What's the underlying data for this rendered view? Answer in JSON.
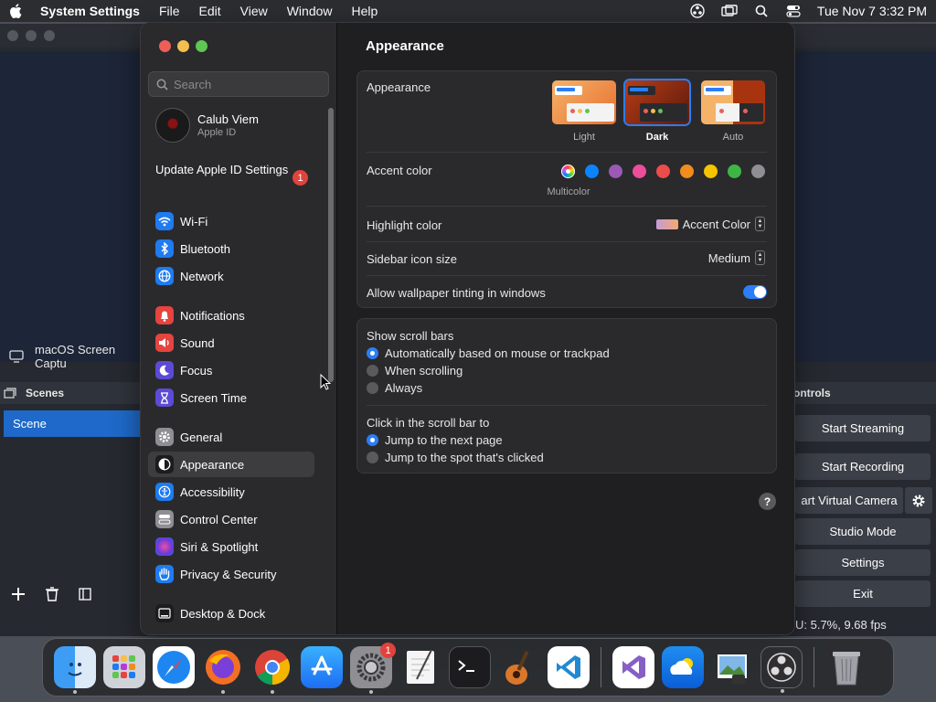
{
  "menubar": {
    "app_name": "System Settings",
    "menus": [
      "File",
      "Edit",
      "View",
      "Window",
      "Help"
    ],
    "clock": "Tue Nov 7  3:32 PM"
  },
  "obs": {
    "source_label": "macOS Screen Captu",
    "scenes_header": "Scenes",
    "scene_item": "Scene",
    "controls_header": "ontrols",
    "buttons": {
      "start_streaming": "Start Streaming",
      "start_recording": "Start Recording",
      "virtual_camera": "art Virtual Camera",
      "studio_mode": "Studio Mode",
      "settings": "Settings",
      "exit": "Exit"
    },
    "status": "U: 5.7%, 9.68 fps"
  },
  "sidebar": {
    "search_placeholder": "Search",
    "profile": {
      "name": "Calub Viem",
      "subtitle": "Apple ID"
    },
    "update": {
      "label": "Update Apple ID Settings",
      "badge": "1"
    },
    "items": [
      {
        "label": "Wi-Fi",
        "icon": "wifi-icon",
        "color": "#1e7bf0"
      },
      {
        "label": "Bluetooth",
        "icon": "bluetooth-icon",
        "color": "#1e7bf0"
      },
      {
        "label": "Network",
        "icon": "globe-icon",
        "color": "#1e7bf0"
      },
      {
        "label": "Notifications",
        "icon": "bell-icon",
        "color": "#e5443f"
      },
      {
        "label": "Sound",
        "icon": "speaker-icon",
        "color": "#e5443f"
      },
      {
        "label": "Focus",
        "icon": "moon-icon",
        "color": "#5b4bd6"
      },
      {
        "label": "Screen Time",
        "icon": "hourglass-icon",
        "color": "#5b4bd6"
      },
      {
        "label": "General",
        "icon": "gear-icon",
        "color": "#8e8e93"
      },
      {
        "label": "Appearance",
        "icon": "appearance-icon",
        "color": "#1c1c1e"
      },
      {
        "label": "Accessibility",
        "icon": "accessibility-icon",
        "color": "#1e7bf0"
      },
      {
        "label": "Control Center",
        "icon": "control-center-icon",
        "color": "#8e8e93"
      },
      {
        "label": "Siri & Spotlight",
        "icon": "siri-icon",
        "color": "#b83ad8"
      },
      {
        "label": "Privacy & Security",
        "icon": "hand-icon",
        "color": "#1e7bf0"
      },
      {
        "label": "Desktop & Dock",
        "icon": "dock-icon",
        "color": "#1c1c1e"
      }
    ]
  },
  "content": {
    "title": "Appearance",
    "appearance": {
      "label": "Appearance",
      "options": [
        "Light",
        "Dark",
        "Auto"
      ],
      "selected": "Dark"
    },
    "accent": {
      "label": "Accent color",
      "caption": "Multicolor",
      "colors": [
        "#0a84ff",
        "#9b59b6",
        "#ec4e9a",
        "#ed4c4c",
        "#f28c1c",
        "#f5c400",
        "#3fb544",
        "#8e8e93"
      ]
    },
    "highlight": {
      "label": "Highlight color",
      "value": "Accent Color"
    },
    "sidebar_icon_size": {
      "label": "Sidebar icon size",
      "value": "Medium"
    },
    "wallpaper_tinting": {
      "label": "Allow wallpaper tinting in windows",
      "enabled": true
    },
    "scroll_bars": {
      "label": "Show scroll bars",
      "options": [
        "Automatically based on mouse or trackpad",
        "When scrolling",
        "Always"
      ],
      "selected": "Automatically based on mouse or trackpad"
    },
    "click_scroll": {
      "label": "Click in the scroll bar to",
      "options": [
        "Jump to the next page",
        "Jump to the spot that's clicked"
      ],
      "selected": "Jump to the next page"
    },
    "help": "?"
  },
  "dock": {
    "apps": [
      "Finder",
      "Launchpad",
      "Safari",
      "Firefox",
      "Chrome",
      "App Store",
      "System Settings",
      "TextEdit",
      "Terminal",
      "GarageBand",
      "Visual Studio Code",
      "Visual Studio",
      "Cloud",
      "Preview",
      "OBS",
      "Trash"
    ],
    "settings_badge": "1"
  }
}
